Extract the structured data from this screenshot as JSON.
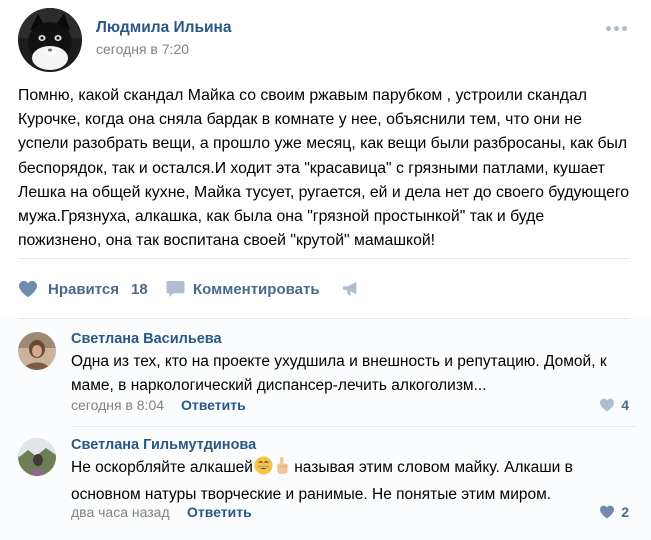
{
  "post": {
    "author": "Людмила Ильина",
    "time": "сегодня в 7:20",
    "text": "Помню, какой скандал Майка со своим ржавым парубком , устроили скандал\nКурочке, когда она сняла бардак в комнате у нее, объяснили тем, что они не\nуспели разобрать вещи, а прошло уже месяц, как вещи были разбросаны, как был\nбеспорядок, так и остался.И ходит эта \"красавица\" с грязными патлами, кушает\nЛешка на общей кухне, Майка тусует, ругается, ей и дела нет до своего будующего\nмужа.Грязнуха, алкашка, как была она \"грязной простынкой\" так и буде\nпожизнено, она так воспитана своей \"крутой\" мамашкой!"
  },
  "actions": {
    "like_label": "Нравится",
    "like_count": "18",
    "comment_label": "Комментировать"
  },
  "comments": [
    {
      "author": "Светлана Васильева",
      "text": "Одна из тех, кто на проекте ухудшила и внешность и репутацию. Домой, к\nмаме, в наркологический диспансер-лечить алкоголизм...",
      "time": "сегодня в 8:04",
      "reply": "Ответить",
      "likes": "4"
    },
    {
      "author": "Светлана Гильмутдинова",
      "text_before": "Не оскорбляйте алкашей",
      "text_after": " называя этим словом майку. Алкаши в",
      "text_line2": "основном натуры творческие и ранимые. Не понятые этим миром.",
      "time": "два часа назад",
      "reply": "Ответить",
      "likes": "2"
    }
  ],
  "icons": {
    "more": "more-dots-icon",
    "like": "heart-icon",
    "comment": "comment-bubble-icon",
    "share": "megaphone-icon",
    "emoji1": "grinning-sweat-emoji-icon",
    "emoji2": "pointing-hand-emoji-icon"
  },
  "colors": {
    "link": "#2a5885",
    "action": "#4a6a8d",
    "icon": "#6f8cad",
    "muted": "#828282"
  }
}
